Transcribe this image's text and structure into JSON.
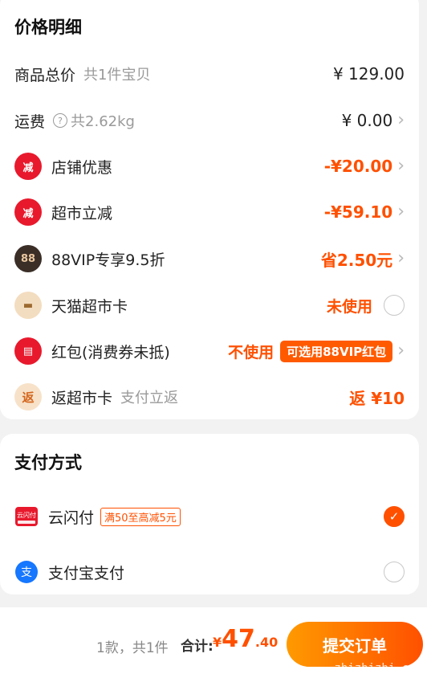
{
  "price_card": {
    "title": "价格明细",
    "rows": [
      {
        "label": "商品总价",
        "sub": "共1件宝贝",
        "amount": "¥ 129.00"
      },
      {
        "label": "运费",
        "sub": "共2.62kg",
        "amount": "¥ 0.00"
      },
      {
        "label": "店铺优惠",
        "amount": "-¥20.00"
      },
      {
        "label": "超市立减",
        "amount": "-¥59.10"
      },
      {
        "label": "88VIP专享9.5折",
        "amount": "省2.50元"
      },
      {
        "label": "天猫超市卡",
        "amount": "未使用"
      },
      {
        "label": "红包(消费券未抵)",
        "amount": "不使用",
        "pill": "可选用88VIP红包"
      },
      {
        "label": "返超市卡",
        "sub": "支付立返",
        "amount": "返 ¥10"
      }
    ],
    "icons": {
      "store_discount": "减",
      "market": "减",
      "vip": "88",
      "card": "▬",
      "redpack": "▤",
      "return": "返"
    }
  },
  "pay_card": {
    "title": "支付方式",
    "methods": [
      {
        "label": "云闪付",
        "promo": "满50至高减5元",
        "selected": true,
        "icon_text": "云闪付"
      },
      {
        "label": "支付宝支付",
        "selected": false,
        "icon_text": "支"
      }
    ]
  },
  "bottom": {
    "count": "1款，共1件",
    "total_label": "合计:",
    "currency": "¥",
    "total_int": "47",
    "total_dec": ".40",
    "submit_label": "提交订单",
    "watermark": "zhizhizhi.com"
  },
  "colors": {
    "accent": "#ff5000",
    "red_icon": "#e8192c"
  }
}
